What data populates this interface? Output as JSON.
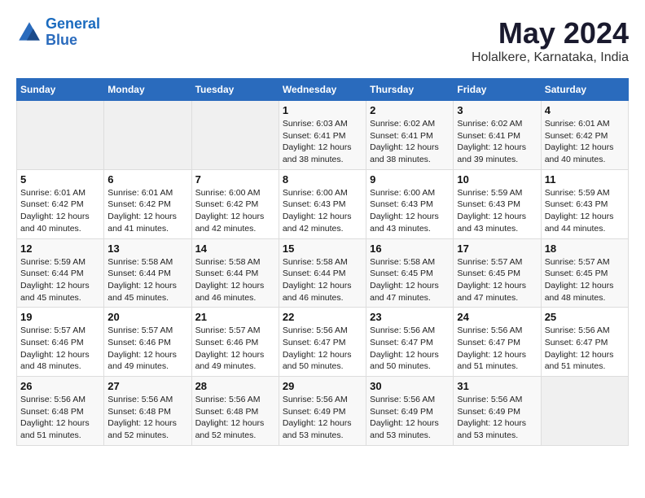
{
  "logo": {
    "line1": "General",
    "line2": "Blue"
  },
  "title": "May 2024",
  "subtitle": "Holalkere, Karnataka, India",
  "days_of_week": [
    "Sunday",
    "Monday",
    "Tuesday",
    "Wednesday",
    "Thursday",
    "Friday",
    "Saturday"
  ],
  "weeks": [
    [
      {
        "num": "",
        "info": ""
      },
      {
        "num": "",
        "info": ""
      },
      {
        "num": "",
        "info": ""
      },
      {
        "num": "1",
        "info": "Sunrise: 6:03 AM\nSunset: 6:41 PM\nDaylight: 12 hours\nand 38 minutes."
      },
      {
        "num": "2",
        "info": "Sunrise: 6:02 AM\nSunset: 6:41 PM\nDaylight: 12 hours\nand 38 minutes."
      },
      {
        "num": "3",
        "info": "Sunrise: 6:02 AM\nSunset: 6:41 PM\nDaylight: 12 hours\nand 39 minutes."
      },
      {
        "num": "4",
        "info": "Sunrise: 6:01 AM\nSunset: 6:42 PM\nDaylight: 12 hours\nand 40 minutes."
      }
    ],
    [
      {
        "num": "5",
        "info": "Sunrise: 6:01 AM\nSunset: 6:42 PM\nDaylight: 12 hours\nand 40 minutes."
      },
      {
        "num": "6",
        "info": "Sunrise: 6:01 AM\nSunset: 6:42 PM\nDaylight: 12 hours\nand 41 minutes."
      },
      {
        "num": "7",
        "info": "Sunrise: 6:00 AM\nSunset: 6:42 PM\nDaylight: 12 hours\nand 42 minutes."
      },
      {
        "num": "8",
        "info": "Sunrise: 6:00 AM\nSunset: 6:43 PM\nDaylight: 12 hours\nand 42 minutes."
      },
      {
        "num": "9",
        "info": "Sunrise: 6:00 AM\nSunset: 6:43 PM\nDaylight: 12 hours\nand 43 minutes."
      },
      {
        "num": "10",
        "info": "Sunrise: 5:59 AM\nSunset: 6:43 PM\nDaylight: 12 hours\nand 43 minutes."
      },
      {
        "num": "11",
        "info": "Sunrise: 5:59 AM\nSunset: 6:43 PM\nDaylight: 12 hours\nand 44 minutes."
      }
    ],
    [
      {
        "num": "12",
        "info": "Sunrise: 5:59 AM\nSunset: 6:44 PM\nDaylight: 12 hours\nand 45 minutes."
      },
      {
        "num": "13",
        "info": "Sunrise: 5:58 AM\nSunset: 6:44 PM\nDaylight: 12 hours\nand 45 minutes."
      },
      {
        "num": "14",
        "info": "Sunrise: 5:58 AM\nSunset: 6:44 PM\nDaylight: 12 hours\nand 46 minutes."
      },
      {
        "num": "15",
        "info": "Sunrise: 5:58 AM\nSunset: 6:44 PM\nDaylight: 12 hours\nand 46 minutes."
      },
      {
        "num": "16",
        "info": "Sunrise: 5:58 AM\nSunset: 6:45 PM\nDaylight: 12 hours\nand 47 minutes."
      },
      {
        "num": "17",
        "info": "Sunrise: 5:57 AM\nSunset: 6:45 PM\nDaylight: 12 hours\nand 47 minutes."
      },
      {
        "num": "18",
        "info": "Sunrise: 5:57 AM\nSunset: 6:45 PM\nDaylight: 12 hours\nand 48 minutes."
      }
    ],
    [
      {
        "num": "19",
        "info": "Sunrise: 5:57 AM\nSunset: 6:46 PM\nDaylight: 12 hours\nand 48 minutes."
      },
      {
        "num": "20",
        "info": "Sunrise: 5:57 AM\nSunset: 6:46 PM\nDaylight: 12 hours\nand 49 minutes."
      },
      {
        "num": "21",
        "info": "Sunrise: 5:57 AM\nSunset: 6:46 PM\nDaylight: 12 hours\nand 49 minutes."
      },
      {
        "num": "22",
        "info": "Sunrise: 5:56 AM\nSunset: 6:47 PM\nDaylight: 12 hours\nand 50 minutes."
      },
      {
        "num": "23",
        "info": "Sunrise: 5:56 AM\nSunset: 6:47 PM\nDaylight: 12 hours\nand 50 minutes."
      },
      {
        "num": "24",
        "info": "Sunrise: 5:56 AM\nSunset: 6:47 PM\nDaylight: 12 hours\nand 51 minutes."
      },
      {
        "num": "25",
        "info": "Sunrise: 5:56 AM\nSunset: 6:47 PM\nDaylight: 12 hours\nand 51 minutes."
      }
    ],
    [
      {
        "num": "26",
        "info": "Sunrise: 5:56 AM\nSunset: 6:48 PM\nDaylight: 12 hours\nand 51 minutes."
      },
      {
        "num": "27",
        "info": "Sunrise: 5:56 AM\nSunset: 6:48 PM\nDaylight: 12 hours\nand 52 minutes."
      },
      {
        "num": "28",
        "info": "Sunrise: 5:56 AM\nSunset: 6:48 PM\nDaylight: 12 hours\nand 52 minutes."
      },
      {
        "num": "29",
        "info": "Sunrise: 5:56 AM\nSunset: 6:49 PM\nDaylight: 12 hours\nand 53 minutes."
      },
      {
        "num": "30",
        "info": "Sunrise: 5:56 AM\nSunset: 6:49 PM\nDaylight: 12 hours\nand 53 minutes."
      },
      {
        "num": "31",
        "info": "Sunrise: 5:56 AM\nSunset: 6:49 PM\nDaylight: 12 hours\nand 53 minutes."
      },
      {
        "num": "",
        "info": ""
      }
    ]
  ]
}
